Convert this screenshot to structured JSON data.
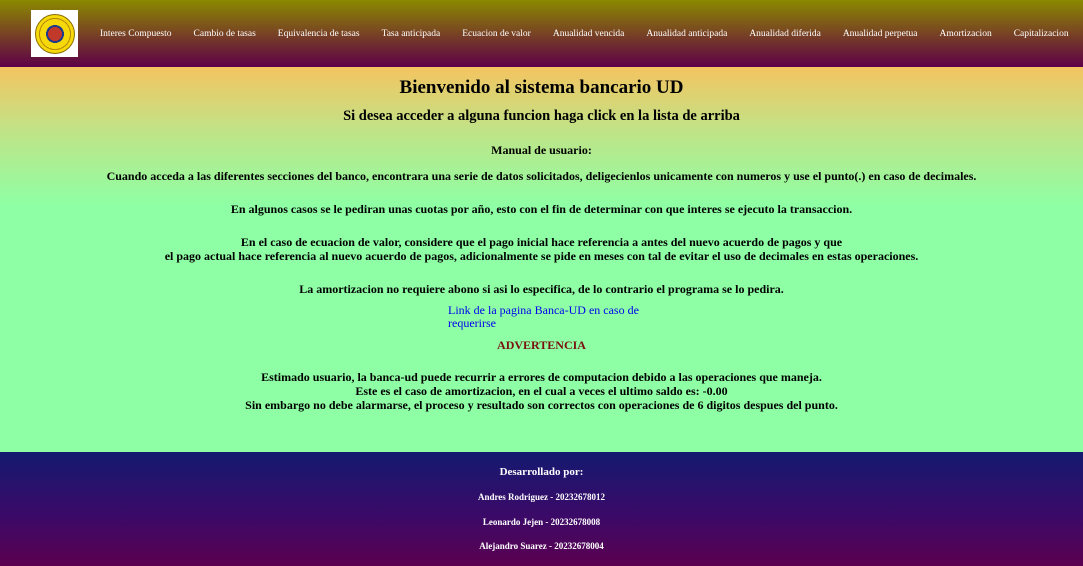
{
  "nav": {
    "links": [
      "Interes Compuesto",
      "Cambio de tasas",
      "Equivalencia de tasas",
      "Tasa anticipada",
      "Ecuacion de valor",
      "Anualidad vencida",
      "Anualidad anticipada",
      "Anualidad diferida",
      "Anualidad perpetua",
      "Amortizacion",
      "Capitalizacion"
    ]
  },
  "main": {
    "title": "Bienvenido al sistema bancario UD",
    "subtitle": "Si desea acceder a alguna funcion haga click en la lista de arriba",
    "manual_title": "Manual de usuario:",
    "paragraphs": [
      "Cuando acceda a las diferentes secciones del banco, encontrara una serie de datos solicitados, deligecienlos unicamente con numeros y use el punto(.) en caso de decimales.",
      "En algunos casos se le pediran unas cuotas por año, esto con el fin de determinar con que interes se ejecuto la transaccion.",
      "En el caso de ecuacion de valor, considere que el pago inicial hace referencia a antes del nuevo acuerdo de pagos y que",
      "el pago actual hace referencia al nuevo acuerdo de pagos, adicionalmente se pide en meses con tal de evitar el uso de decimales en estas operaciones.",
      "La amortizacion no requiere abono si asi lo especifica, de lo contrario el programa se lo pedira."
    ],
    "link_text": "Link de la pagina Banca-UD en caso de requerirse",
    "warning_title": "ADVERTENCIA",
    "warning_lines": [
      "Estimado usuario, la banca-ud puede recurrir a errores de computacion debido a las operaciones que maneja.",
      "Este es el caso de amortizacion, en el cual a veces el ultimo saldo es: -0.00",
      "Sin embargo no debe alarmarse, el proceso y resultado son correctos con operaciones de 6 digitos despues del punto."
    ]
  },
  "footer": {
    "title": "Desarrollado por:",
    "authors": [
      "Andres Rodriguez - 20232678012",
      "Leonardo Jejen - 20232678008",
      "Alejandro Suarez - 20232678004"
    ]
  },
  "colors": {
    "link": "#0000ee",
    "warning": "#7a1010",
    "main_bg": "#8effa4"
  }
}
